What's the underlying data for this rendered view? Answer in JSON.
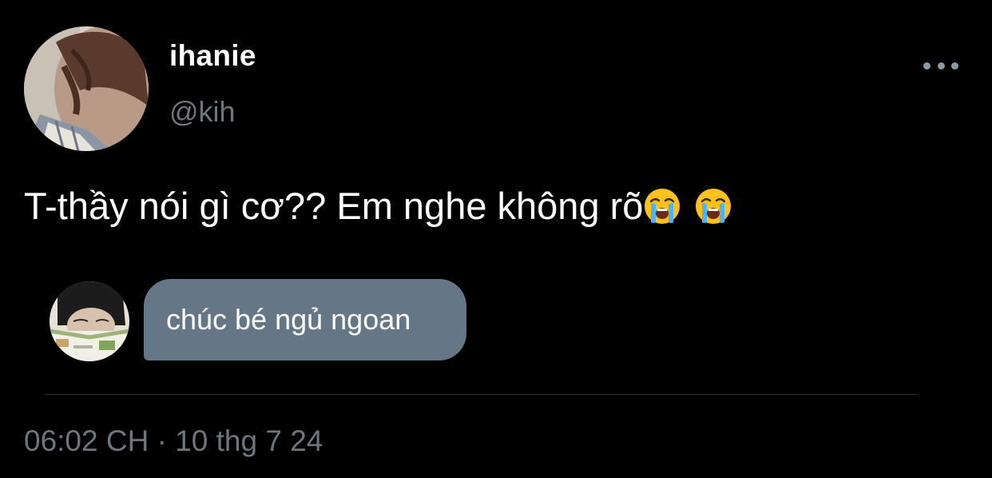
{
  "author": {
    "display_name": "ihanie",
    "handle": "@kih"
  },
  "tweet": {
    "text": "T-thầy nói gì cơ?? Em nghe không rõ",
    "emojis": [
      "loudly-crying-face-icon",
      "loudly-crying-face-icon"
    ]
  },
  "reply": {
    "message": "chúc bé ngủ ngoan"
  },
  "meta": {
    "timestamp": "06:02 CH · 10 thg 7 24"
  },
  "colors": {
    "background": "#000000",
    "secondary_text": "#6e767d",
    "bubble": "#657786",
    "divider": "#2f3336"
  }
}
